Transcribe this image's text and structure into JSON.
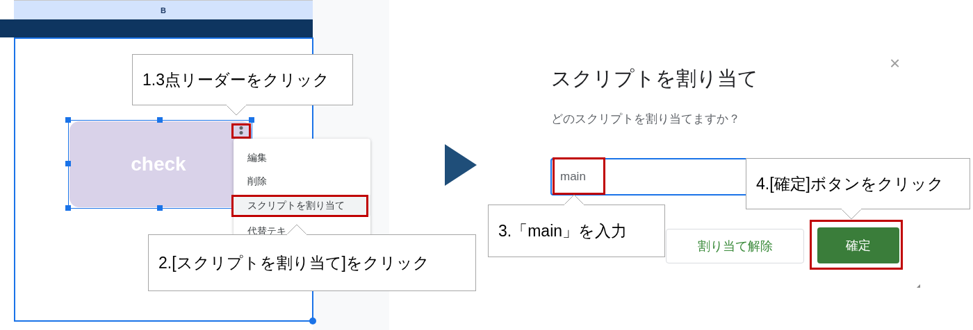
{
  "sheet": {
    "column_header": "B",
    "shape": {
      "label": "check",
      "selected": true
    },
    "menu": [
      {
        "label": "編集",
        "highlighted": false
      },
      {
        "label": "削除",
        "highlighted": false
      },
      {
        "label": "スクリプトを割り当て",
        "highlighted": true
      },
      {
        "label": "代替テキ",
        "highlighted": false
      }
    ]
  },
  "dialog": {
    "title": "スクリプトを割り当て",
    "close": "×",
    "prompt": "どのスクリプトを割り当てますか？",
    "input": {
      "value": "main",
      "focused": true
    },
    "buttons": [
      {
        "label": "割り当て解除",
        "kind": "secondary"
      },
      {
        "label": "確定",
        "kind": "primary"
      }
    ]
  },
  "callouts": [
    {
      "text": "1.3点リーダーをクリック"
    },
    {
      "text": "2.[スクリプトを割り当て]をクリック"
    },
    {
      "text": "3.「main」を入力"
    },
    {
      "text": "4.[確定]ボタンをクリック"
    }
  ]
}
